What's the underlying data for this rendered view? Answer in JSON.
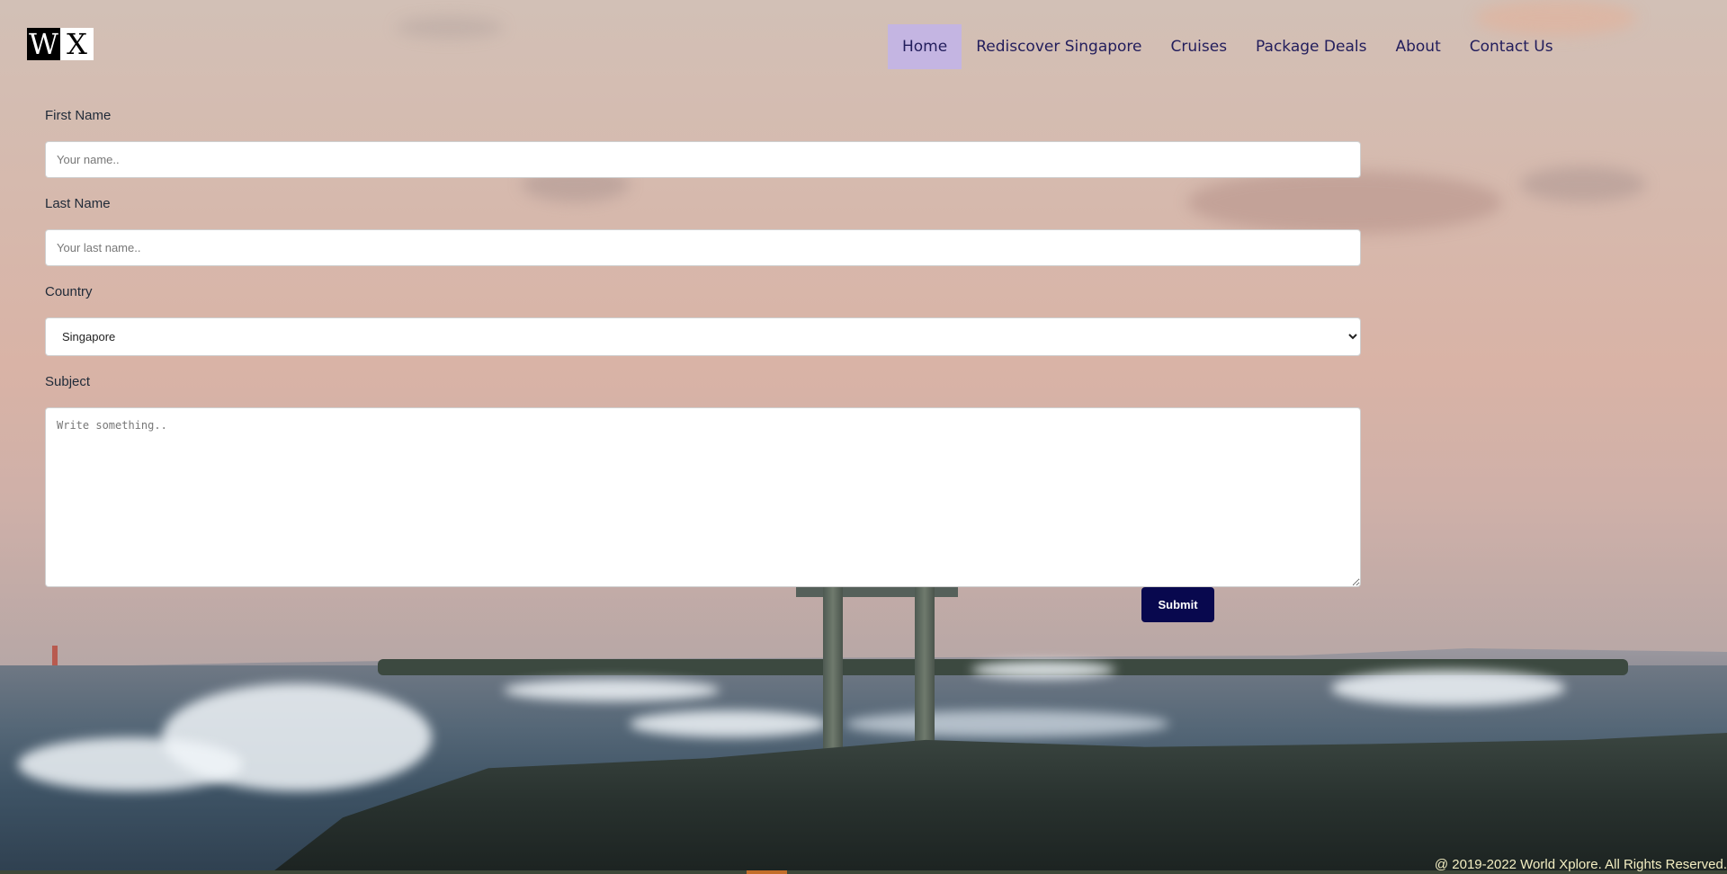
{
  "logo": {
    "letter1": "W",
    "letter2": "X"
  },
  "nav": {
    "items": [
      {
        "label": "Home"
      },
      {
        "label": "Rediscover Singapore"
      },
      {
        "label": "Cruises"
      },
      {
        "label": "Package Deals"
      },
      {
        "label": "About"
      },
      {
        "label": "Contact Us"
      }
    ],
    "active": "Home"
  },
  "form": {
    "first_name": {
      "label": "First Name",
      "placeholder": "Your name..",
      "value": ""
    },
    "last_name": {
      "label": "Last Name",
      "placeholder": "Your last name..",
      "value": ""
    },
    "country": {
      "label": "Country",
      "selected": "Singapore"
    },
    "subject": {
      "label": "Subject",
      "placeholder": "Write something..",
      "value": ""
    },
    "submit_label": "Submit"
  },
  "footer": {
    "text": "@ 2019-2022 World Xplore. All Rights Reserved."
  },
  "colors": {
    "active_nav_bg": "#c4b5e2",
    "nav_text": "#221d5c",
    "submit_bg": "#08084e",
    "footer_text": "#f3eec2"
  },
  "icons": [
    "chevron-down-icon",
    "resize-handle-icon"
  ]
}
